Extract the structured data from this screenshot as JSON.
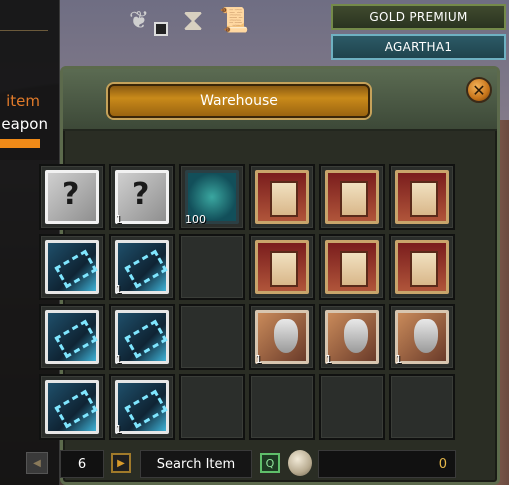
{
  "side_panel": {
    "item_label": "item",
    "weapon_label": "eapon"
  },
  "top_badges": {
    "gold": "GOLD PREMIUM",
    "realm": "AGARTHA1"
  },
  "top_icons": [
    "wings-icon",
    "hourglass-icon",
    "scroll-map-icon"
  ],
  "warehouse": {
    "title": "Warehouse",
    "slots": [
      [
        {
          "type": "mystery",
          "qty": ""
        },
        {
          "type": "mystery",
          "qty": "1"
        },
        {
          "type": "jar",
          "qty": "100"
        },
        {
          "type": "scroll",
          "qty": ""
        },
        {
          "type": "scroll",
          "qty": ""
        },
        {
          "type": "scroll",
          "qty": ""
        }
      ],
      [
        {
          "type": "chain",
          "qty": ""
        },
        {
          "type": "chain",
          "qty": "1"
        },
        {
          "type": "empty",
          "qty": ""
        },
        {
          "type": "scroll",
          "qty": ""
        },
        {
          "type": "scroll",
          "qty": ""
        },
        {
          "type": "scroll",
          "qty": ""
        }
      ],
      [
        {
          "type": "chain",
          "qty": ""
        },
        {
          "type": "chain",
          "qty": "1"
        },
        {
          "type": "empty",
          "qty": ""
        },
        {
          "type": "head",
          "qty": "1"
        },
        {
          "type": "head",
          "qty": "1"
        },
        {
          "type": "head",
          "qty": "1"
        }
      ],
      [
        {
          "type": "chain",
          "qty": ""
        },
        {
          "type": "chain",
          "qty": "1"
        },
        {
          "type": "empty",
          "qty": ""
        },
        {
          "type": "empty",
          "qty": ""
        },
        {
          "type": "empty",
          "qty": ""
        },
        {
          "type": "empty",
          "qty": ""
        }
      ]
    ]
  },
  "bottom": {
    "page": "6",
    "search_label": "Search Item",
    "currency_value": "0"
  }
}
